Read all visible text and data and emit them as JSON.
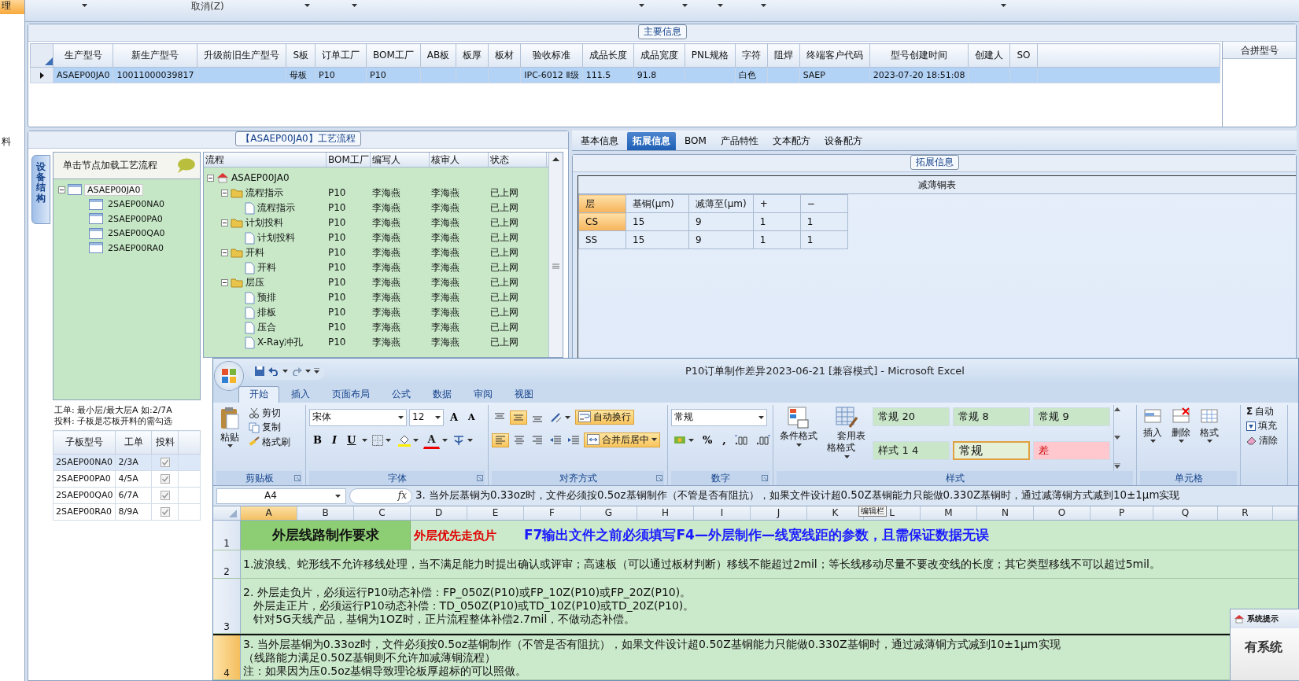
{
  "sidebar": {
    "items": [
      {
        "label": "理",
        "selected": true
      },
      {
        "label": "料",
        "selected": false
      }
    ]
  },
  "toolbar": {
    "buttons": [
      "取消(Z)"
    ]
  },
  "main_info": {
    "title": "主要信息",
    "row_selected": true,
    "columns": [
      {
        "label": "生产型号",
        "value": "ASAEP00JA0"
      },
      {
        "label": "新生产型号",
        "value": "10011000039817"
      },
      {
        "label": "升级前旧生产型号"
      },
      {
        "label": "S板",
        "value": "母板"
      },
      {
        "label": "订单工厂",
        "value": "P10"
      },
      {
        "label": "BOM工厂",
        "value": "P10"
      },
      {
        "label": "AB板"
      },
      {
        "label": "板厚"
      },
      {
        "label": "板材"
      },
      {
        "label": "验收标准",
        "value": "IPC-6012 Ⅱ级"
      },
      {
        "label": "成品长度",
        "value": "111.5"
      },
      {
        "label": "成品宽度",
        "value": "91.8"
      },
      {
        "label": "PNL规格"
      },
      {
        "label": "字符",
        "value": "白色"
      },
      {
        "label": "阻焊"
      },
      {
        "label": "终端客户代码",
        "value": "SAEP"
      },
      {
        "label": "型号创建时间",
        "value": "2023-07-20 18:51:08"
      },
      {
        "label": "创建人"
      },
      {
        "label": "SO"
      }
    ],
    "merge_panel": {
      "title": "合拼型号"
    }
  },
  "process": {
    "title": "【ASAEP00JA0】工艺流程",
    "side_tab": {
      "label": "设备结构",
      "selected": true
    },
    "hint": "单击节点加载工艺流程",
    "tree": [
      {
        "label": "ASAEP00JA0",
        "expanded": true,
        "selected": true,
        "children": [
          {
            "label": "2SAEP00NA0",
            "selected": false
          },
          {
            "label": "2SAEP00PA0",
            "selected": false
          },
          {
            "label": "2SAEP00QA0",
            "selected": false
          },
          {
            "label": "2SAEP00RA0",
            "selected": false
          }
        ]
      }
    ],
    "notes": [
      "工单: 最小层/最大层A 如:2/7A",
      "投料: 子板是芯板开料的需勾选"
    ],
    "sub_boards": {
      "columns": [
        "子板型号",
        "工单",
        "投料"
      ],
      "rows": [
        {
          "model": "2SAEP00NA0",
          "order": "2/3A",
          "checked": true,
          "selected": true
        },
        {
          "model": "2SAEP00PA0",
          "order": "4/5A",
          "checked": true,
          "selected": false
        },
        {
          "model": "2SAEP00QA0",
          "order": "6/7A",
          "checked": true,
          "selected": false
        },
        {
          "model": "2SAEP00RA0",
          "order": "8/9A",
          "checked": true,
          "selected": false
        }
      ]
    },
    "flow": {
      "columns": [
        "流程",
        "BOM工厂",
        "编写人",
        "核审人",
        "状态"
      ],
      "tree": [
        {
          "kind": "root",
          "label": "ASAEP00JA0",
          "expanded": true,
          "children": [
            {
              "kind": "folder",
              "label": "流程指示",
              "expanded": true,
              "factory": "P10",
              "writer": "李海燕",
              "reviewer": "李海燕",
              "status": "已上网",
              "children": [
                {
                  "kind": "file",
                  "label": "流程指示",
                  "factory": "P10",
                  "writer": "李海燕",
                  "reviewer": "李海燕",
                  "status": "已上网"
                }
              ]
            },
            {
              "kind": "folder",
              "label": "计划投料",
              "expanded": true,
              "factory": "P10",
              "writer": "李海燕",
              "reviewer": "李海燕",
              "status": "已上网",
              "children": [
                {
                  "kind": "file",
                  "label": "计划投料",
                  "factory": "P10",
                  "writer": "李海燕",
                  "reviewer": "李海燕",
                  "status": "已上网"
                }
              ]
            },
            {
              "kind": "folder",
              "label": "开料",
              "expanded": true,
              "factory": "P10",
              "writer": "李海燕",
              "reviewer": "李海燕",
              "status": "已上网",
              "children": [
                {
                  "kind": "file",
                  "label": "开料",
                  "factory": "P10",
                  "writer": "李海燕",
                  "reviewer": "李海燕",
                  "status": "已上网"
                }
              ]
            },
            {
              "kind": "folder",
              "label": "层压",
              "expanded": true,
              "factory": "P10",
              "writer": "李海燕",
              "reviewer": "李海燕",
              "status": "已上网",
              "children": [
                {
                  "kind": "file",
                  "label": "预排",
                  "factory": "P10",
                  "writer": "李海燕",
                  "reviewer": "李海燕",
                  "status": "已上网"
                },
                {
                  "kind": "file",
                  "label": "排板",
                  "factory": "P10",
                  "writer": "李海燕",
                  "reviewer": "李海燕",
                  "status": "已上网"
                },
                {
                  "kind": "file",
                  "label": "压合",
                  "factory": "P10",
                  "writer": "李海燕",
                  "reviewer": "李海燕",
                  "status": "已上网"
                },
                {
                  "kind": "file",
                  "label": "X-Ray冲孔",
                  "factory": "P10",
                  "writer": "李海燕",
                  "reviewer": "李海燕",
                  "status": "已上网"
                }
              ]
            }
          ]
        }
      ]
    }
  },
  "detail": {
    "tabs": [
      {
        "label": "基本信息",
        "selected": false
      },
      {
        "label": "拓展信息",
        "selected": true
      },
      {
        "label": "BOM",
        "selected": false
      },
      {
        "label": "产品特性",
        "selected": false
      },
      {
        "label": "文本配方",
        "selected": false
      },
      {
        "label": "设备配方",
        "selected": false
      }
    ],
    "group_title": "拓展信息",
    "table_title": "减薄铜表",
    "columns": [
      "层",
      "基铜(μm)",
      "减薄至(μm)",
      "+",
      "−"
    ],
    "rows": [
      {
        "selected": true,
        "values": [
          "CS",
          "15",
          "9",
          "1",
          "1"
        ]
      },
      {
        "selected": false,
        "values": [
          "SS",
          "15",
          "9",
          "1",
          "1"
        ]
      }
    ]
  },
  "excel": {
    "title": "P10订单制作差异2023-06-21  [兼容模式] - Microsoft Excel",
    "tabs": [
      {
        "label": "开始",
        "selected": true
      },
      {
        "label": "插入",
        "selected": false
      },
      {
        "label": "页面布局",
        "selected": false
      },
      {
        "label": "公式",
        "selected": false
      },
      {
        "label": "数据",
        "selected": false
      },
      {
        "label": "审阅",
        "selected": false
      },
      {
        "label": "视图",
        "selected": false
      }
    ],
    "clipboard": {
      "group": "剪贴板",
      "paste": "粘贴",
      "items": [
        "剪切",
        "复制",
        "格式刷"
      ]
    },
    "font": {
      "group": "字体",
      "name": "宋体",
      "size": "12",
      "grow": "A",
      "shrink": "A",
      "buttons": [
        "B",
        "I",
        "U"
      ],
      "color_button": "A"
    },
    "alignment": {
      "group": "对齐方式",
      "vertical": [
        {
          "selected": false
        },
        {
          "selected": true
        },
        {
          "selected": false
        }
      ],
      "horizontal": [
        {
          "selected": true
        },
        {
          "selected": false
        },
        {
          "selected": false
        }
      ],
      "wrap": {
        "label": "自动换行",
        "on": true
      },
      "merge": {
        "label": "合并后居中",
        "on": true
      }
    },
    "number": {
      "group": "数字",
      "format": "常规",
      "buttons": [
        "%",
        ","
      ]
    },
    "styles": {
      "group": "样式",
      "buttons": [
        "条件格式",
        "套用表格格式"
      ],
      "cells": [
        {
          "label": "常规 20",
          "color": "#c9e6c9",
          "selected": false
        },
        {
          "label": "常规 8",
          "color": "#c9e6c9",
          "selected": false
        },
        {
          "label": "常规 9",
          "color": "#c9e6c9",
          "selected": false
        },
        {
          "label": "样式 1 4",
          "color": "#c9e6c9",
          "selected": false
        },
        {
          "label": "常规",
          "color": "#e4f0d8",
          "selected": true
        },
        {
          "label": "差",
          "color": "#ffc7ce",
          "selected": false
        }
      ]
    },
    "cells": {
      "group": "单元格",
      "buttons": [
        "插入",
        "删除",
        "格式"
      ]
    },
    "editing": [
      {
        "symbol": "Σ",
        "label": "自动"
      },
      {
        "label": "填充"
      },
      {
        "label": "清除"
      }
    ],
    "name_box": "A4",
    "fx": "fx",
    "formula": "3. 当外层基铜为0.33oz时，文件必须按0.5oz基铜制作（不管是否有阻抗），如果文件设计超0.50Z基铜能力只能做0.330Z基铜时，通过减薄铜方式减到10±1μm实现",
    "formula_tip": "编辑栏",
    "columns": [
      "A",
      "B",
      "C",
      "D",
      "E",
      "F",
      "G",
      "H",
      "I",
      "J",
      "K",
      "L",
      "M",
      "N",
      "O",
      "P",
      "Q",
      "R"
    ],
    "rows": [
      {
        "number": "1",
        "kind": "headline",
        "selected": false,
        "title": "外层线路制作要求",
        "red": "外层优先走负片",
        "blue": "F7输出文件之前必须填写F4—外层制作—线宽线距的参数，且需保证数据无误"
      },
      {
        "number": "2",
        "kind": "text",
        "selected": false,
        "lines": [
          "1.波浪线、蛇形线不允许移线处理，当不满足能力时提出确认或评审；高速板（可以通过板材判断）移线不能超过2mil；等长线移动尽量不要改变线的长度；其它类型移线不可以超过5mil。"
        ]
      },
      {
        "number": "3",
        "kind": "text",
        "selected": false,
        "lines": [
          "2. 外层走负片，必须运行P10动态补偿：FP_050Z(P10)或FP_10Z(P10)或FP_20Z(P10)。",
          "   外层走正片，必须运行P10动态补偿：TD_050Z(P10)或TD_10Z(P10)或TD_20Z(P10)。",
          "   针对5G天线产品，基铜为1OZ时，正片流程整体补偿2.7mil，不做动态补偿。"
        ]
      },
      {
        "number": "4",
        "kind": "text",
        "selected": true,
        "lines": [
          "3. 当外层基铜为0.33oz时，文件必须按0.5oz基铜制作（不管是否有阻抗），如果文件设计超0.50Z基铜能力只能做0.330Z基铜时，通过减薄铜方式减到10±1μm实现",
          "（线路能力满足0.50Z基铜则不允许加减薄铜流程）",
          "注：如果因为压0.5oz基铜导致理论板厚超标的可以照做。"
        ]
      }
    ]
  },
  "notification": {
    "title": "系统提示",
    "text": "有系统"
  }
}
